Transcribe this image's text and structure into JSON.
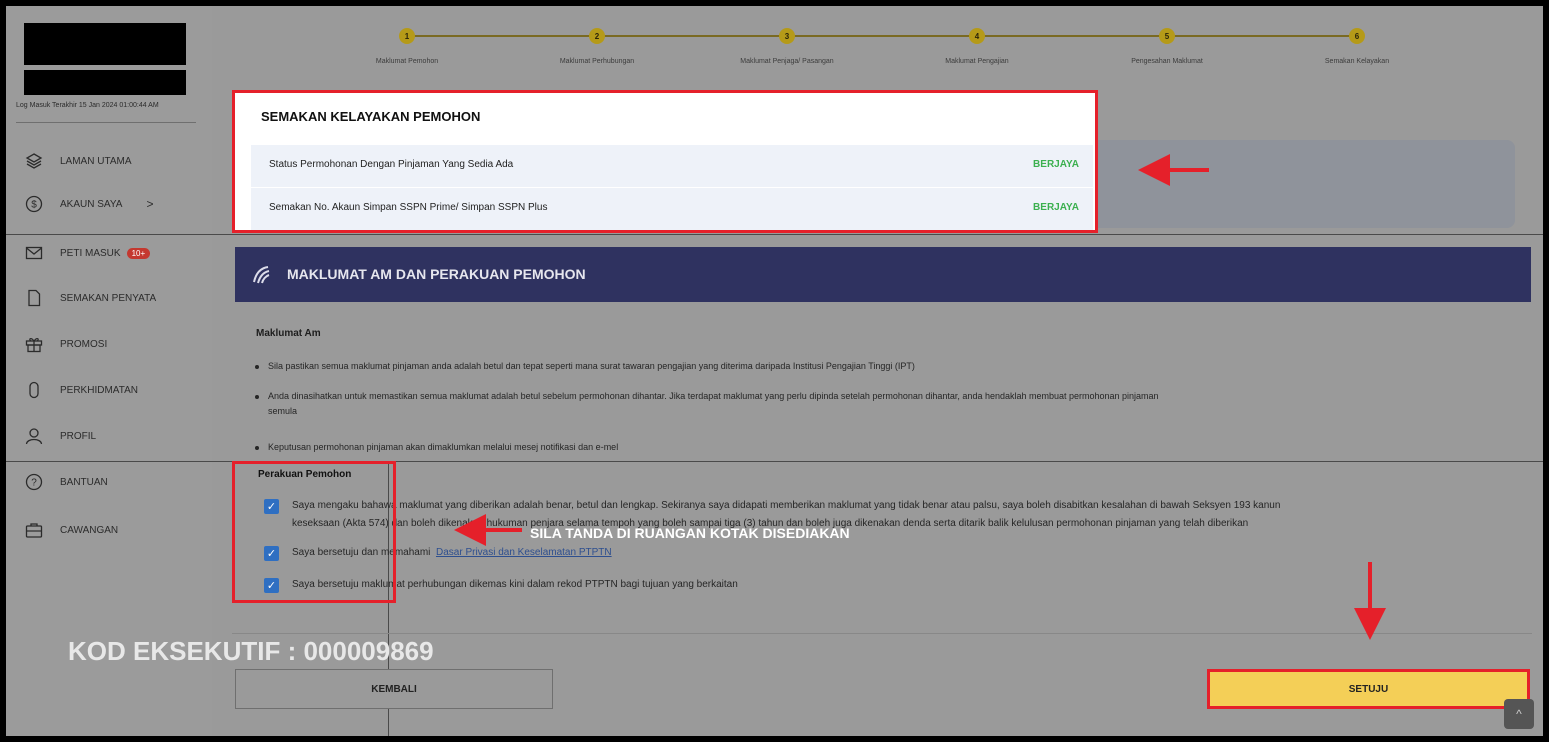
{
  "sidebar": {
    "last_login": "Log Masuk Terakhir 15 Jan 2024 01:00:44 AM",
    "items": [
      {
        "label": "LAMAN UTAMA",
        "icon": "layers-icon"
      },
      {
        "label": "AKAUN SAYA",
        "icon": "dollar-circle-icon",
        "chevron": ">"
      },
      {
        "label": "PETI MASUK",
        "icon": "mail-icon",
        "badge": "10+"
      },
      {
        "label": "SEMAKAN PENYATA",
        "icon": "document-icon"
      },
      {
        "label": "PROMOSI",
        "icon": "gift-icon"
      },
      {
        "label": "PERKHIDMATAN",
        "icon": "phone-icon"
      },
      {
        "label": "PROFIL",
        "icon": "user-icon"
      },
      {
        "label": "BANTUAN",
        "icon": "help-icon"
      },
      {
        "label": "CAWANGAN",
        "icon": "briefcase-icon"
      }
    ]
  },
  "stepper": {
    "steps": [
      {
        "num": "1",
        "label": "Maklumat Pemohon"
      },
      {
        "num": "2",
        "label": "Maklumat Perhubungan"
      },
      {
        "num": "3",
        "label": "Maklumat Penjaga/ Pasangan"
      },
      {
        "num": "4",
        "label": "Maklumat Pengajian"
      },
      {
        "num": "5",
        "label": "Pengesahan Maklumat"
      },
      {
        "num": "6",
        "label": "Semakan Kelayakan"
      }
    ]
  },
  "semakan": {
    "title": "SEMAKAN KELAYAKAN PEMOHON",
    "rows": [
      {
        "label": "Status Permohonan Dengan Pinjaman Yang Sedia Ada",
        "status": "BERJAYA"
      },
      {
        "label": "Semakan No. Akaun Simpan SSPN Prime/ Simpan SSPN Plus",
        "status": "BERJAYA"
      }
    ]
  },
  "maklumat_am": {
    "header": "MAKLUMAT AM DAN PERAKUAN PEMOHON",
    "subtitle": "Maklumat Am",
    "bullets": [
      "Sila pastikan semua maklumat pinjaman anda adalah betul dan tepat seperti mana surat tawaran pengajian yang diterima daripada Institusi Pengajian Tinggi (IPT)",
      "Anda dinasihatkan untuk memastikan semua maklumat adalah betul sebelum permohonan dihantar. Jika terdapat maklumat yang perlu dipinda setelah permohonan dihantar, anda hendaklah membuat permohonan pinjaman",
      "semula",
      "Keputusan permohonan pinjaman akan dimaklumkan melalui mesej notifikasi dan e-mel"
    ]
  },
  "perakuan": {
    "title": "Perakuan Pemohon",
    "items": [
      {
        "line1": "Saya mengaku bahawa maklumat yang diberikan adalah benar, betul dan lengkap. Sekiranya saya didapati memberikan maklumat yang tidak benar atau palsu, saya boleh disabitkan kesalahan di bawah Seksyen 193 kanun",
        "line2": "keseksaan (Akta 574) dan boleh dikenakan hukuman penjara selama tempoh yang boleh sampai tiga (3) tahun dan boleh juga dikenakan denda serta ditarik balik kelulusan permohonan pinjaman yang telah diberikan",
        "checked": true
      },
      {
        "text": "Saya bersetuju dan memahami",
        "link": "Dasar Privasi dan Keselamatan PTPTN",
        "checked": true
      },
      {
        "text": "Saya bersetuju maklumat perhubungan dikemas kini dalam rekod PTPTN bagi tujuan yang berkaitan",
        "checked": true
      }
    ]
  },
  "annotation": {
    "text": "SILA TANDA DI RUANGAN KOTAK DISEDIAKAN",
    "kod": "KOD EKSEKUTIF : 000009869",
    "arrow_color": "#e5202a"
  },
  "buttons": {
    "kembali": "KEMBALI",
    "setuju": "SETUJU",
    "scroll_top": "^"
  }
}
